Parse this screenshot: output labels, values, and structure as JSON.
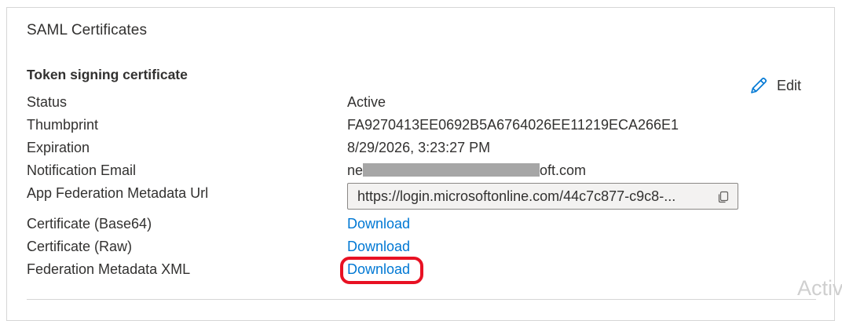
{
  "card": {
    "title": "SAML Certificates"
  },
  "token_signing": {
    "heading": "Token signing certificate",
    "edit_label": "Edit",
    "rows": [
      {
        "label": "Status",
        "value": "Active"
      },
      {
        "label": "Thumbprint",
        "value": "FA9270413EE0692B5A6764026EE11219ECA266E1"
      },
      {
        "label": "Expiration",
        "value": "8/29/2026, 3:23:27 PM"
      },
      {
        "label": "Notification Email",
        "value_prefix": "ne",
        "value_suffix": "oft.com"
      },
      {
        "label": "App Federation Metadata Url",
        "value": "https://login.microsoftonline.com/44c7c877-c9c8-..."
      },
      {
        "label": "Certificate (Base64)",
        "value": "Download"
      },
      {
        "label": "Certificate (Raw)",
        "value": "Download"
      },
      {
        "label": "Federation Metadata XML",
        "value": "Download"
      }
    ]
  },
  "watermark": "Activ",
  "colors": {
    "link": "#0078d4",
    "highlight": "#e81123",
    "text": "#323130",
    "redaction": "#a6a6a6"
  },
  "icons": {
    "edit": "pencil-icon",
    "copy": "copy-icon"
  }
}
